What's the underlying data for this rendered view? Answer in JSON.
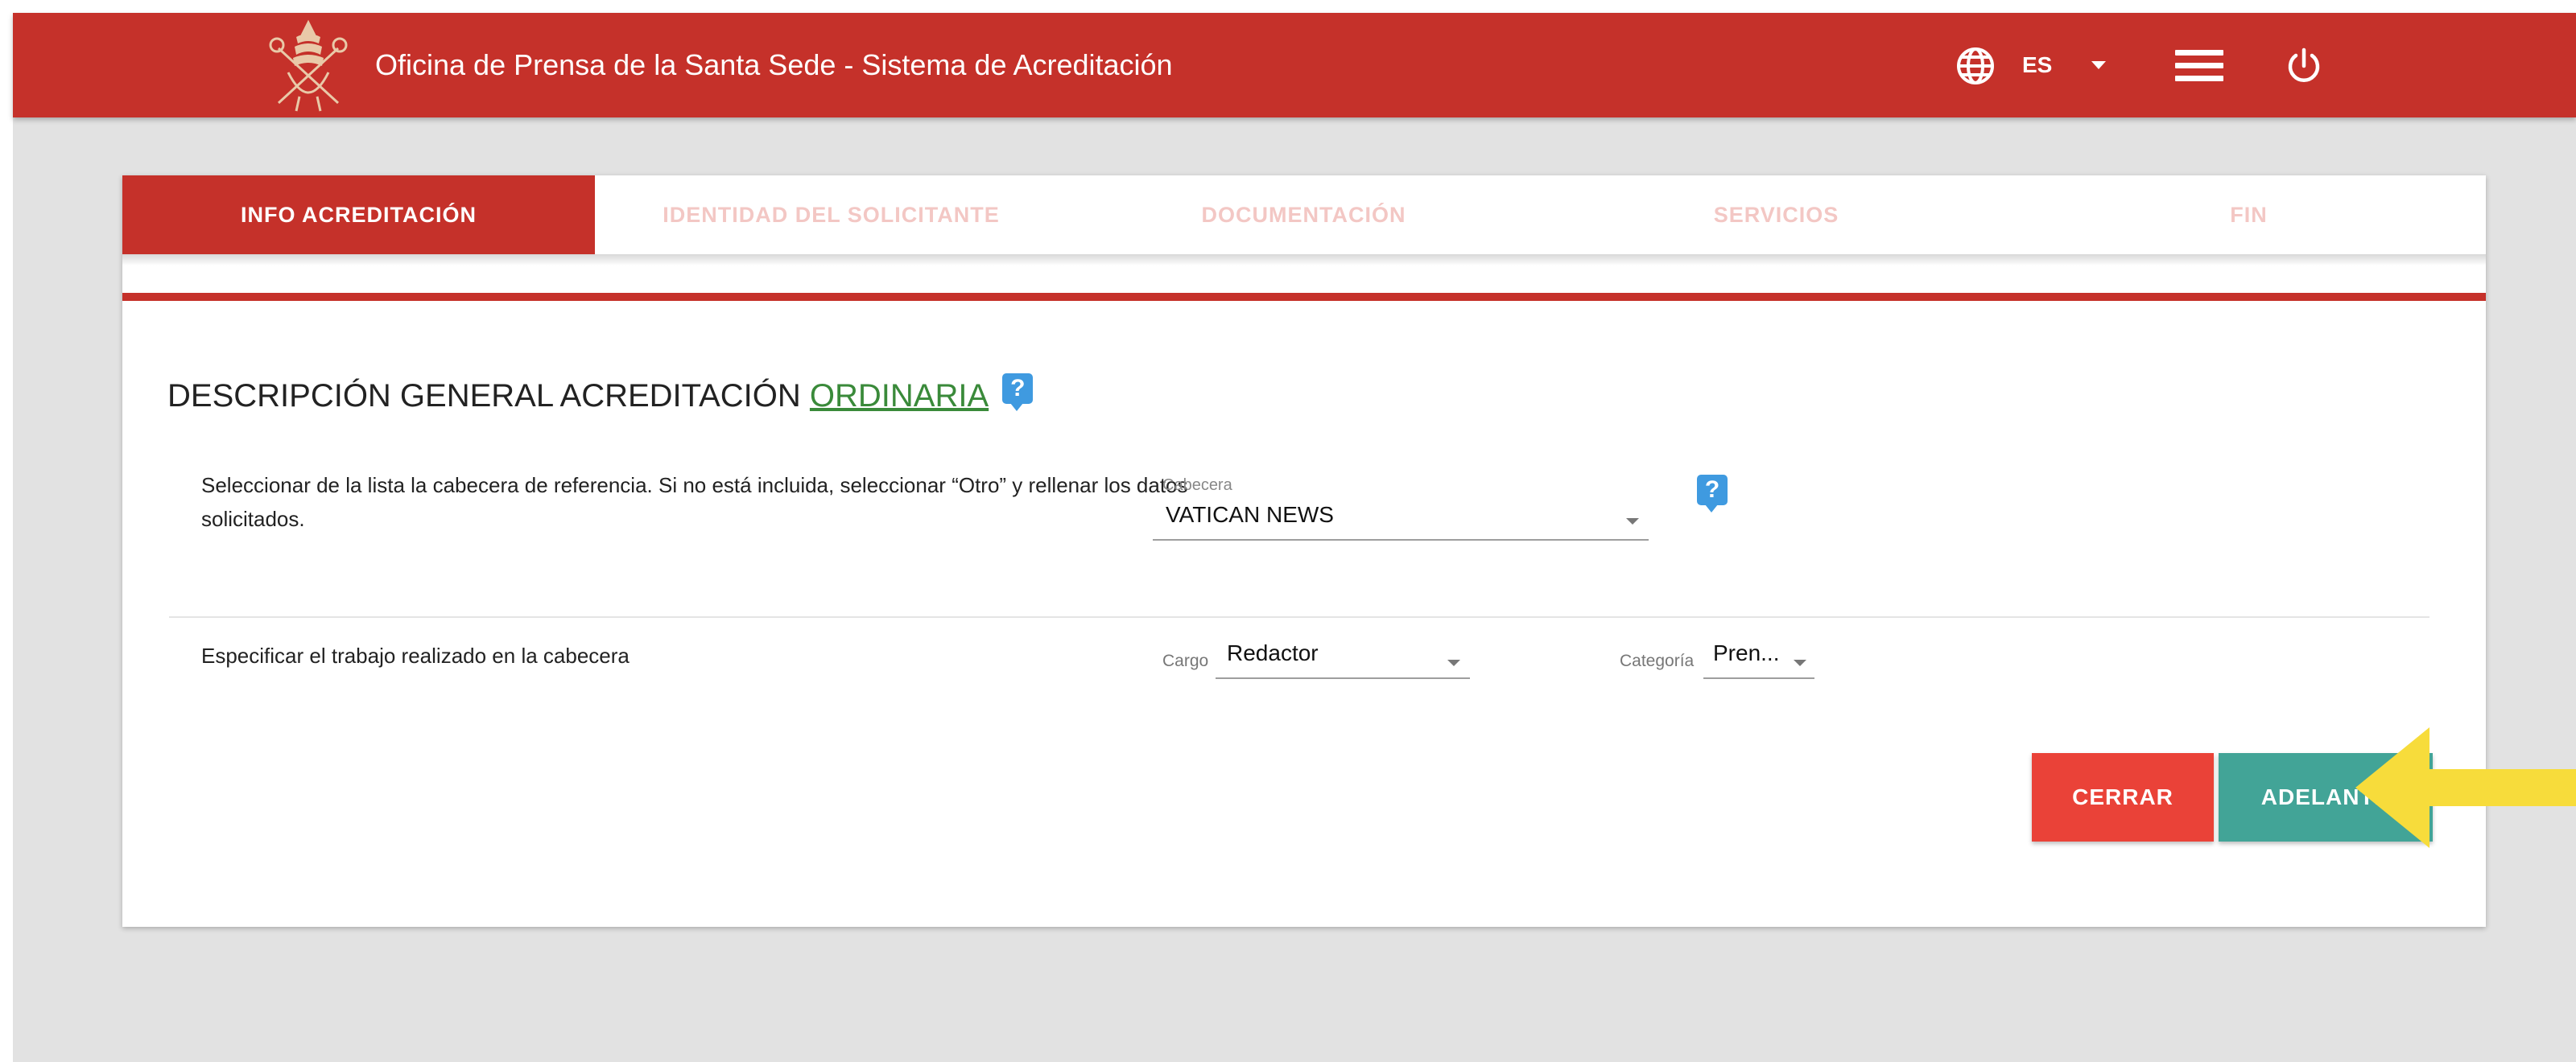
{
  "header": {
    "title": "Oficina de Prensa de la Santa Sede - Sistema de Acreditación",
    "language": "ES",
    "logo_icon": "papal-coat-of-arms-logo",
    "globe_icon": "globe-icon",
    "menu_icon": "hamburger-menu-icon",
    "power_icon": "power-icon"
  },
  "tabs": [
    {
      "label": "INFO ACREDITACIÓN",
      "active": true
    },
    {
      "label": "IDENTIDAD DEL SOLICITANTE",
      "active": false
    },
    {
      "label": "DOCUMENTACIÓN",
      "active": false
    },
    {
      "label": "SERVICIOS",
      "active": false
    },
    {
      "label": "FIN",
      "active": false
    }
  ],
  "section": {
    "heading": "DESCRIPCIÓN GENERAL ACREDITACIÓN",
    "accreditation_type": "ORDINARIA",
    "help_label": "?"
  },
  "row1": {
    "description": "Seleccionar de la lista la cabecera de referencia. Si no está incluida, seleccionar “Otro” y rellenar los datos solicitados.",
    "field_label": "Cabecera",
    "field_value": "VATICAN NEWS",
    "help_label": "?"
  },
  "row2": {
    "description": "Especificar el trabajo realizado en la cabecera",
    "cargo_label": "Cargo",
    "cargo_value": "Redactor",
    "categoria_label": "Categoría",
    "categoria_value": "Pren..."
  },
  "buttons": {
    "close_label": "CERRAR",
    "next_label": "ADELANTE"
  },
  "colors": {
    "brand_red": "#c5312a",
    "close_button": "#ea4238",
    "next_button": "#42a497",
    "accent_green": "#3a8a3a",
    "help_blue": "#3f9ae0",
    "pointer_yellow": "#f7dc3b"
  }
}
